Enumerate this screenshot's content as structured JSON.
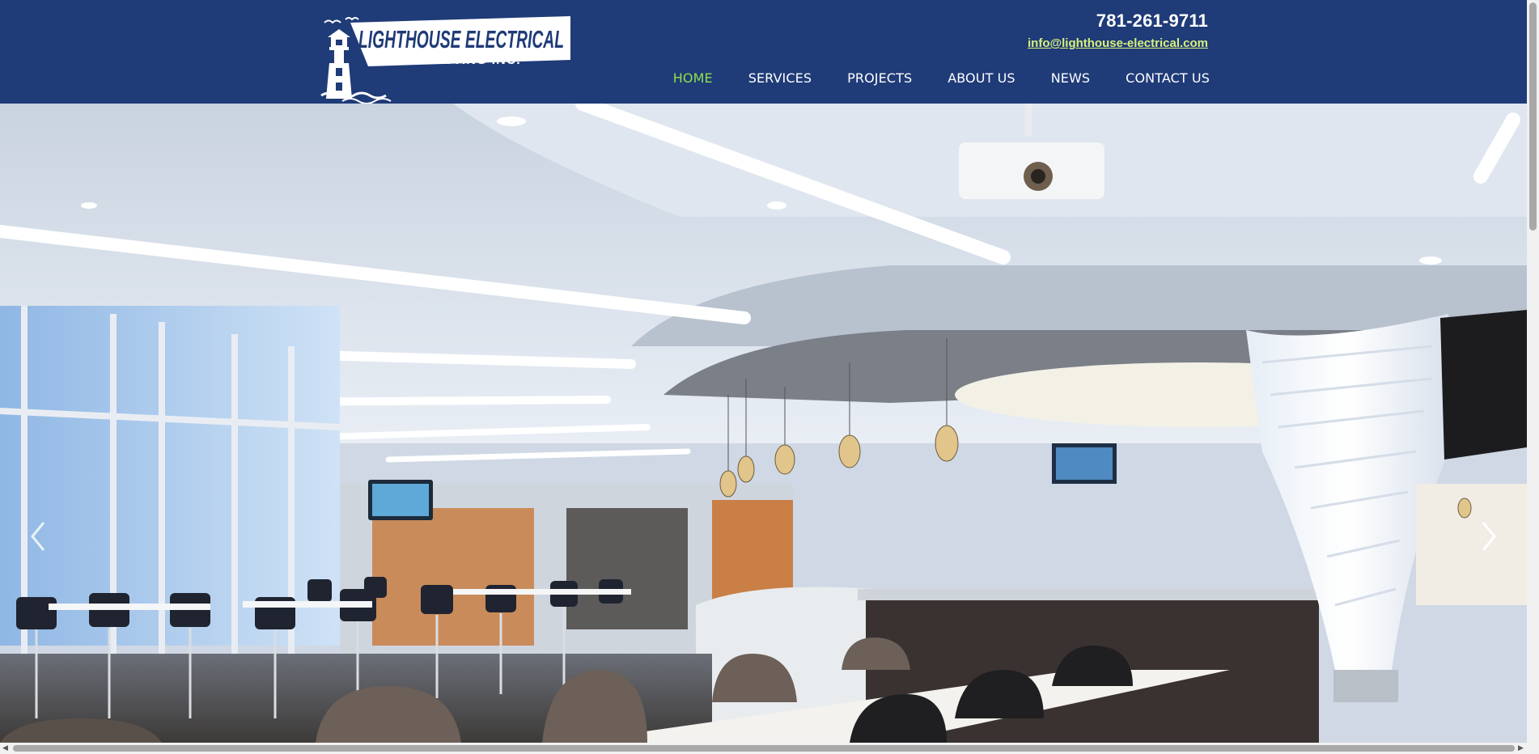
{
  "brand": {
    "name_line1": "LIGHTHOUSE ELECTRICAL",
    "name_line2": "CONTRACTING INC."
  },
  "contact": {
    "phone": "781-261-9711",
    "email": "info@lighthouse-electrical.com"
  },
  "nav": {
    "items": [
      {
        "label": "HOME",
        "active": true
      },
      {
        "label": "SERVICES",
        "active": false
      },
      {
        "label": "PROJECTS",
        "active": false
      },
      {
        "label": "ABOUT US",
        "active": false
      },
      {
        "label": "NEWS",
        "active": false
      },
      {
        "label": "CONTACT US",
        "active": false
      }
    ]
  },
  "slider": {
    "prev_icon": "chevron-left-icon",
    "next_icon": "chevron-right-icon",
    "slide_description_icon": "cafeteria-photo"
  },
  "colors": {
    "header_bg": "#1f3b78",
    "nav_active": "#8fe04a",
    "email_link": "#d7f07a"
  }
}
